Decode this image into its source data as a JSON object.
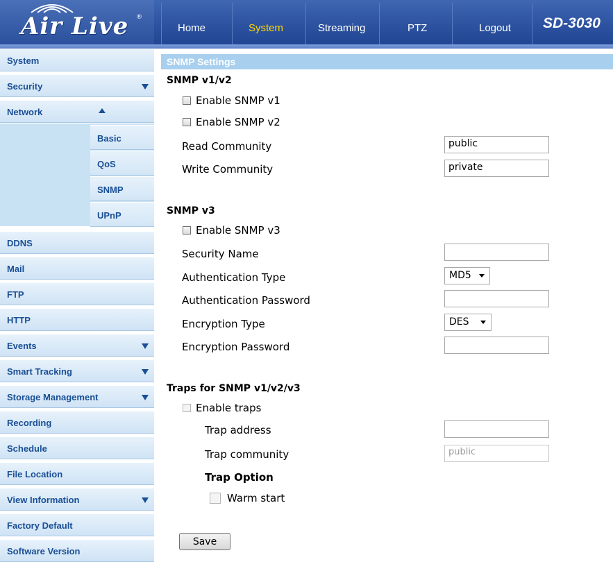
{
  "header": {
    "logo_text": "Air Live",
    "logo_mark": "®",
    "nav": [
      "Home",
      "System",
      "Streaming",
      "PTZ",
      "Logout"
    ],
    "model": "SD-3030"
  },
  "sidebar": {
    "items": {
      "system": "System",
      "security": "Security",
      "network": "Network",
      "ddns": "DDNS",
      "mail": "Mail",
      "ftp": "FTP",
      "http": "HTTP",
      "events": "Events",
      "smart_tracking": "Smart Tracking",
      "storage_management": "Storage Management",
      "recording": "Recording",
      "schedule": "Schedule",
      "file_location": "File Location",
      "view_information": "View Information",
      "factory_default": "Factory Default",
      "software_version": "Software Version"
    },
    "network_sub": [
      "Basic",
      "QoS",
      "SNMP",
      "UPnP"
    ]
  },
  "main": {
    "section_title": "SNMP Settings",
    "v1v2": {
      "heading": "SNMP v1/v2",
      "enable_v1": "Enable SNMP v1",
      "enable_v2": "Enable SNMP v2",
      "read_community_label": "Read Community",
      "read_community_value": "public",
      "write_community_label": "Write Community",
      "write_community_value": "private"
    },
    "v3": {
      "heading": "SNMP v3",
      "enable_v3": "Enable SNMP v3",
      "security_name_label": "Security Name",
      "security_name_value": "",
      "auth_type_label": "Authentication Type",
      "auth_type_value": "MD5",
      "auth_password_label": "Authentication Password",
      "auth_password_value": "",
      "enc_type_label": "Encryption Type",
      "enc_type_value": "DES",
      "enc_password_label": "Encryption Password",
      "enc_password_value": ""
    },
    "traps": {
      "heading": "Traps for SNMP v1/v2/v3",
      "enable_traps": "Enable traps",
      "trap_address_label": "Trap address",
      "trap_address_value": "",
      "trap_community_label": "Trap community",
      "trap_community_value": "public",
      "trap_option_label": "Trap Option",
      "warm_start": "Warm start"
    },
    "save_label": "Save"
  }
}
